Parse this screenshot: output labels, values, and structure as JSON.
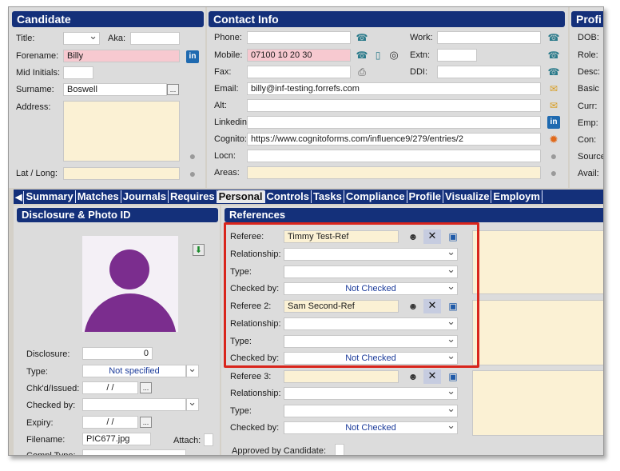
{
  "candidate": {
    "title": "Candidate",
    "labels": {
      "title": "Title:",
      "aka": "Aka:",
      "forename": "Forename:",
      "mid": "Mid Initials:",
      "surname": "Surname:",
      "address": "Address:",
      "latlong": "Lat / Long:"
    },
    "forename": "Billy",
    "surname": "Boswell",
    "surname_btn": "...",
    "linkedin_icon": "in"
  },
  "contact": {
    "title": "Contact Info",
    "labels": {
      "phone": "Phone:",
      "mobile": "Mobile:",
      "fax": "Fax:",
      "email": "Email:",
      "alt": "Alt:",
      "linkedin": "Linkedin:",
      "cognito": "Cognito:",
      "locn": "Locn:",
      "areas": "Areas:",
      "work": "Work:",
      "extn": "Extn:",
      "ddi": "DDI:"
    },
    "mobile": "07100 10 20 30",
    "email": "billy@inf-testing.forrefs.com",
    "cognito": "https://www.cognitoforms.com/influence9/279/entries/2"
  },
  "profile": {
    "title": "Profi",
    "labels": [
      "DOB:",
      "Role:",
      "Desc:",
      "Basic",
      "Curr:",
      "Emp:",
      "Con:",
      "Source",
      "Avail:"
    ]
  },
  "tabs": {
    "back": "◀",
    "items": [
      "Summary",
      "Matches",
      "Journals",
      "Requires",
      "Personal",
      "Controls",
      "Tasks",
      "Compliance",
      "Profile",
      "Visualize",
      "Employm"
    ],
    "active": "Personal"
  },
  "disclosure": {
    "title": "Disclosure & Photo ID",
    "labels": {
      "disclosure": "Disclosure:",
      "type": "Type:",
      "chk": "Chk'd/Issued:",
      "checked_by": "Checked by:",
      "expiry": "Expiry:",
      "filename": "Filename:",
      "attach": "Attach:",
      "compl": "Compl Type:"
    },
    "disclosure_value": "0",
    "type_value": "Not specified",
    "chk_value": "/    /",
    "expiry_value": "/    /",
    "filename": "PIC677.jpg",
    "date_btn": "..."
  },
  "references": {
    "title": "References",
    "labels": {
      "relationship": "Relationship:",
      "type": "Type:",
      "checked_by": "Checked by:",
      "approved": "Approved by Candidate:"
    },
    "items": [
      {
        "label": "Referee:",
        "name": "Timmy Test-Ref",
        "checked": "Not Checked"
      },
      {
        "label": "Referee 2:",
        "name": "Sam Second-Ref",
        "checked": "Not Checked"
      },
      {
        "label": "Referee 3:",
        "name": "",
        "checked": "Not Checked"
      }
    ]
  },
  "colors": {
    "header": "#14307a",
    "highlight": "#d9251c",
    "pink": "#f7c9d0",
    "cream": "#fbf1d4",
    "avatar": "#7b2d8e"
  }
}
